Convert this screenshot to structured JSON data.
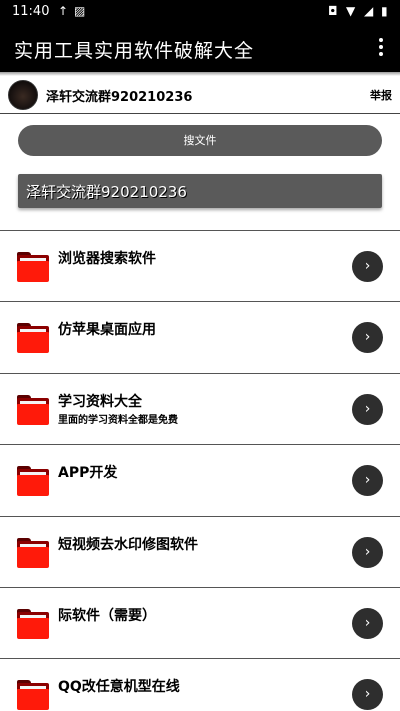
{
  "status_bar": {
    "time": "11:40",
    "icons": [
      "upload-arrow-icon",
      "no-sim-icon",
      "camera-icon",
      "wifi-icon",
      "no-signal-icon",
      "battery-icon"
    ]
  },
  "app_bar": {
    "title": "实用工具实用软件破解大全",
    "menu_icon": "more-vert-icon"
  },
  "profile": {
    "name": "泽轩交流群920210236",
    "report_label": "举报"
  },
  "search_button": {
    "label": "搜文件"
  },
  "notice": {
    "text": "泽轩交流群920210236"
  },
  "list": {
    "items": [
      {
        "label": "浏览器搜索软件",
        "sublabel": ""
      },
      {
        "label": "仿苹果桌面应用",
        "sublabel": ""
      },
      {
        "label": "学习资料大全",
        "sublabel": "里面的学习资料全都是免费"
      },
      {
        "label": "APP开发",
        "sublabel": ""
      },
      {
        "label": "短视频去水印修图软件",
        "sublabel": ""
      },
      {
        "label": "际软件（需要）",
        "sublabel": ""
      },
      {
        "label": "QQ改任意机型在线",
        "sublabel": ""
      }
    ],
    "folder_icon": "red-folder-icon",
    "arrow_icon": "chevron-right-icon",
    "arrow_glyph": "›"
  }
}
